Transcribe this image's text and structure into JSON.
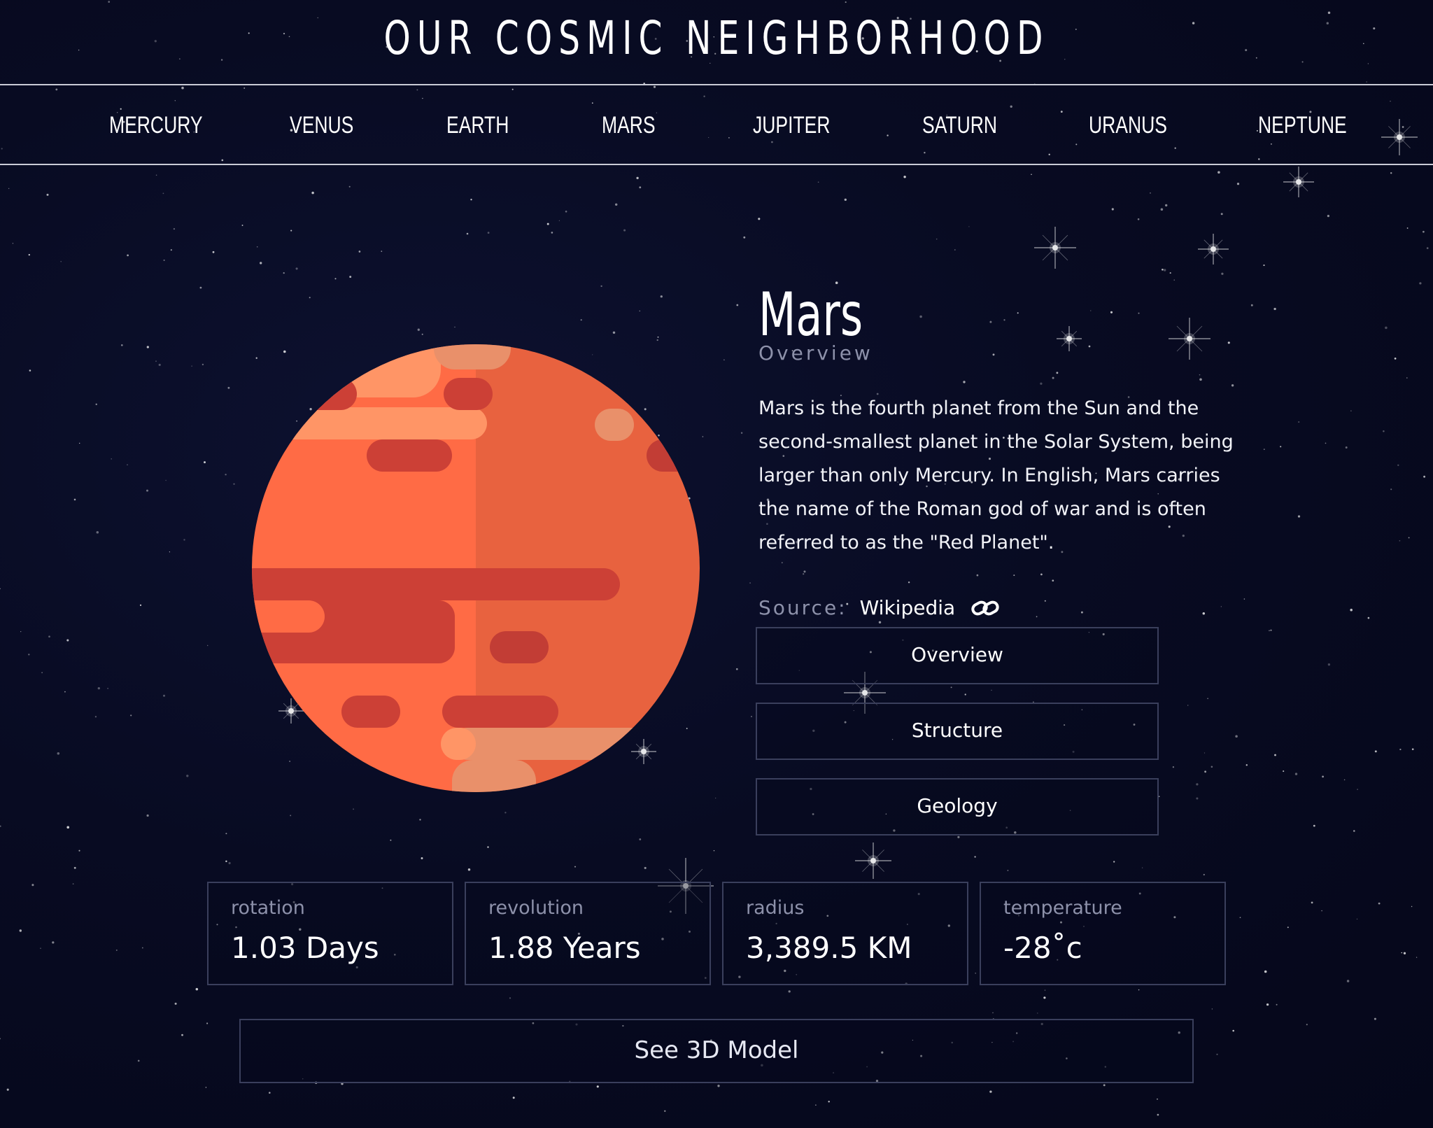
{
  "header": {
    "title": "OUR COSMIC NEIGHBORHOOD"
  },
  "nav": {
    "items": [
      {
        "label": "MERCURY"
      },
      {
        "label": "VENUS"
      },
      {
        "label": "EARTH"
      },
      {
        "label": "MARS"
      },
      {
        "label": "JUPITER"
      },
      {
        "label": "SATURN"
      },
      {
        "label": "URANUS"
      },
      {
        "label": "NEPTUNE"
      }
    ]
  },
  "planet": {
    "name": "Mars",
    "section": "Overview",
    "description": "Mars is the fourth planet from the Sun and the second-smallest planet in the Solar System, being larger than only Mercury. In English, Mars carries the name of the Roman god of war and is often referred to as the \"Red Planet\".",
    "source_label": "Source:",
    "source_link": "Wikipedia",
    "source_icon": "link-icon",
    "colors": {
      "base": "#ff6b45",
      "shade": "#e8623f",
      "band": "#cc4036",
      "light": "#ff9566",
      "light_shade": "#e9906a"
    }
  },
  "tabs": [
    {
      "label": "Overview"
    },
    {
      "label": "Structure"
    },
    {
      "label": "Geology"
    }
  ],
  "stats": [
    {
      "label": "rotation",
      "value": "1.03 Days"
    },
    {
      "label": "revolution",
      "value": "1.88 Years"
    },
    {
      "label": "radius",
      "value": "3,389.5 KM"
    },
    {
      "label": "temperature",
      "value": "-28˚c"
    }
  ],
  "model_button": {
    "label": "See 3D Model"
  },
  "theme": {
    "background": "#070a1e",
    "border": "#3a3f5c",
    "muted_text": "#8d91aa"
  }
}
